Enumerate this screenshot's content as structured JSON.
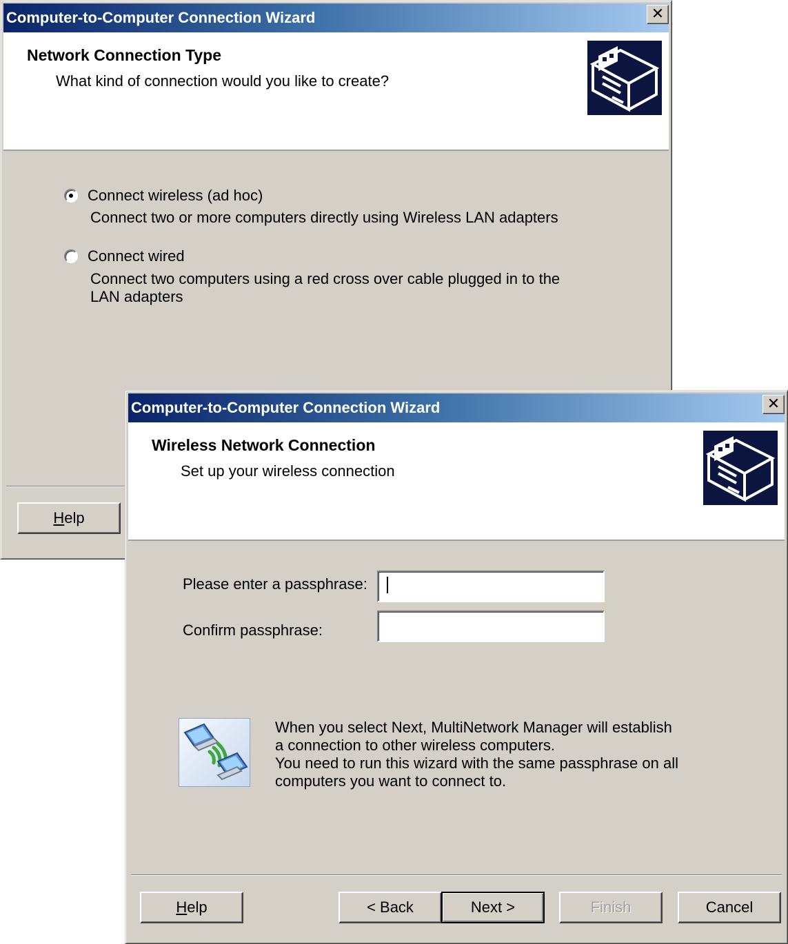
{
  "back_window": {
    "title": "Computer-to-Computer Connection Wizard",
    "close_glyph": "✕",
    "header": {
      "title": "Network Connection Type",
      "subtitle": "What kind of connection would you like to create?"
    },
    "options": [
      {
        "label": "Connect wireless (ad hoc)",
        "description": "Connect two or more computers directly using Wireless LAN adapters",
        "selected": true
      },
      {
        "label": "Connect wired",
        "description_line1": "Connect two computers using a red cross over cable plugged in to the",
        "description_line2": "LAN adapters",
        "selected": false
      }
    ],
    "buttons": {
      "help_mnemonic": "H",
      "help_rest": "elp"
    }
  },
  "front_window": {
    "title": "Computer-to-Computer Connection Wizard",
    "close_glyph": "✕",
    "header": {
      "title": "Wireless Network Connection",
      "subtitle": "Set up your wireless connection"
    },
    "passphrase_label": "Please enter a passphrase:",
    "passphrase_value": "",
    "confirm_label": "Confirm passphrase:",
    "confirm_value": "",
    "info_lines": [
      "When you select Next, MultiNetwork Manager will establish",
      "a connection to other wireless computers.",
      "You need to run this wizard with the same passphrase on all",
      "computers you want to connect to."
    ],
    "buttons": {
      "help_mnemonic": "H",
      "help_rest": "elp",
      "back": "< Back",
      "next": "Next >",
      "finish": "Finish",
      "cancel": "Cancel"
    },
    "icon": "wireless-computers-icon"
  },
  "colors": {
    "window_face": "#d4d0c8",
    "title_start": "#0a246a",
    "title_end": "#a6caf0",
    "logo_bg": "#0b1540"
  }
}
